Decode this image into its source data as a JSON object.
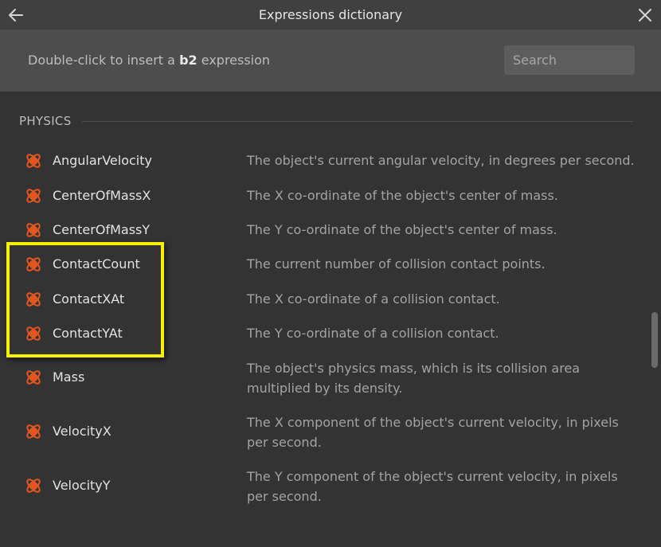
{
  "window": {
    "title": "Expressions dictionary"
  },
  "header": {
    "hint_prefix": "Double-click to insert a",
    "hint_bold": "b2",
    "hint_suffix": "expression",
    "search_placeholder": "Search"
  },
  "section": {
    "title": "PHYSICS"
  },
  "items": [
    {
      "name": "AngularVelocity",
      "description": "The object's current angular velocity, in degrees per second."
    },
    {
      "name": "CenterOfMassX",
      "description": "The X co-ordinate of the object's center of mass."
    },
    {
      "name": "CenterOfMassY",
      "description": "The Y co-ordinate of the object's center of mass."
    },
    {
      "name": "ContactCount",
      "description": "The current number of collision contact points."
    },
    {
      "name": "ContactXAt",
      "description": "The X co-ordinate of a collision contact."
    },
    {
      "name": "ContactYAt",
      "description": "The Y co-ordinate of a collision contact."
    },
    {
      "name": "Mass",
      "description": "The object's physics mass, which is its collision area multiplied by its density."
    },
    {
      "name": "VelocityX",
      "description": "The X component of the object's current velocity, in pixels per second."
    },
    {
      "name": "VelocityY",
      "description": "The Y component of the object's current velocity, in pixels per second."
    }
  ],
  "colors": {
    "icon_accent": "#e2561f",
    "highlight": "#f7f000"
  },
  "icons": {
    "back": "arrow-left-icon",
    "close": "close-icon",
    "item": "physics-behavior-icon"
  }
}
